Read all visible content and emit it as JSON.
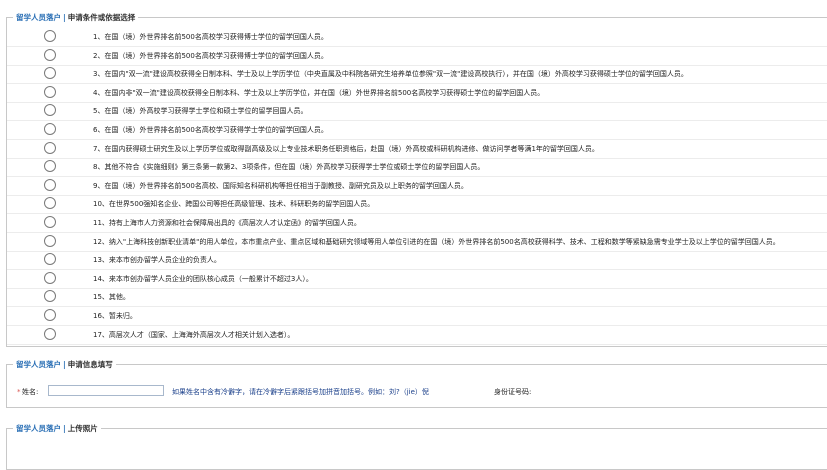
{
  "section_prefix": "留学人员落户",
  "sections": [
    {
      "title": "申请条件或依据选择"
    },
    {
      "title": "申请信息填写"
    },
    {
      "title": "上传照片"
    }
  ],
  "options": [
    "1、在国（境）外世界排名前500名高校学习获得博士学位的留学回国人员。",
    "2、在国（境）外世界排名前500名高校学习获得博士学位的留学回国人员。",
    "3、在国内\"双一流\"建设高校获得全日制本科、学士及以上学历学位（中央直属及中科院各研究生培养单位参照\"双一流\"建设高校执行），并在国（境）外高校学习获得硕士学位的留学回国人员。",
    "4、在国内非\"双一流\"建设高校获得全日制本科、学士及以上学历学位，并在国（境）外世界排名前500名高校学习获得硕士学位的留学回国人员。",
    "5、在国（境）外高校学习获得学士学位和硕士学位的留学回国人员。",
    "6、在国（境）外世界排名前500名高校学习获得学士学位的留学回国人员。",
    "7、在国内获得硕士研究生及以上学历学位或取得副高级及以上专业技术职务任职资格后，赴国（境）外高校或科研机构进修、做访问学者等满1年的留学回国人员。",
    "8、其他不符合《实施细则》第三条第一款第2、3项条件，但在国（境）外高校学习获得学士学位或硕士学位的留学回国人员。",
    "9、在国（境）外世界排名前500名高校、国际知名科研机构等担任相当于副教授、副研究员及以上职务的留学回国人员。",
    "10、在世界500强知名企业、跨国公司等担任高级管理、技术、科研职务的留学回国人员。",
    "11、持有上海市人力资源和社会保障局出具的《高层次人才认定函》的留学回国人员。",
    "12、纳入\"上海科技创新职业清单\"的用人单位，本市重点产业、重点区域和基础研究领域等用人单位引进的在国（境）外世界排名前500名高校获得科学、技术、工程和数学等紧缺急需专业学士及以上学位的留学回国人员。",
    "13、来本市创办留学人员企业的负责人。",
    "14、来本市创办留学人员企业的团队核心成员（一般累计不超过3人）。",
    "15、其他。",
    "16、暂未归。",
    "17、高层次人才（国家、上海海外高层次人才相关计划入选者）。"
  ],
  "form": {
    "required_mark": "*",
    "name_label": "姓名:",
    "name_value": "",
    "name_hint": "如果姓名中含有冷僻字，请在冷僻字后紧跟括号加拼音加括号。例如：刘?（jie）倪",
    "id_label": "身份证号码:"
  }
}
